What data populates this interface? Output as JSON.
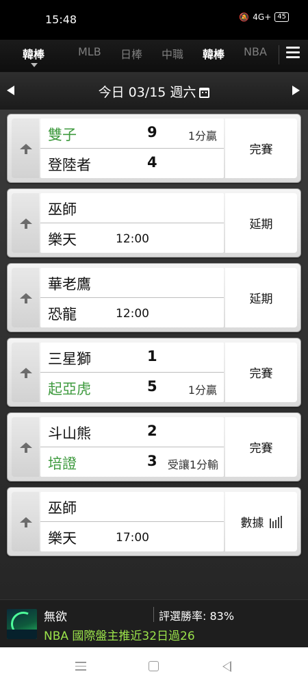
{
  "status_bar": {
    "time": "15:48",
    "signal": "4G+",
    "battery": "45"
  },
  "tabs": [
    {
      "label": "韓棒",
      "active": true
    },
    {
      "label": "MLB",
      "active": false
    },
    {
      "label": "日棒",
      "active": false
    },
    {
      "label": "中職",
      "active": false
    },
    {
      "label": "韓棒",
      "active": false
    },
    {
      "label": "NBA",
      "active": false
    }
  ],
  "date_bar": {
    "label": "今日 03/15 週六"
  },
  "games": [
    {
      "home": "雙子",
      "home_score": "9",
      "home_note": "1分贏",
      "home_win": true,
      "away": "登陸者",
      "away_score": "4",
      "away_note": "",
      "time": "",
      "status": "完賽"
    },
    {
      "home": "巫師",
      "home_score": "",
      "home_note": "",
      "away": "樂天",
      "away_score": "",
      "away_note": "",
      "time": "12:00",
      "status": "延期"
    },
    {
      "home": "華老鷹",
      "home_score": "",
      "home_note": "",
      "away": "恐龍",
      "away_score": "",
      "away_note": "",
      "time": "12:00",
      "status": "延期"
    },
    {
      "home": "三星獅",
      "home_score": "1",
      "home_note": "",
      "away": "起亞虎",
      "away_score": "5",
      "away_note": "1分贏",
      "away_win": true,
      "time": "",
      "status": "完賽"
    },
    {
      "home": "斗山熊",
      "home_score": "2",
      "home_note": "",
      "away": "培證",
      "away_score": "3",
      "away_note": "受讓1分輸",
      "away_win": true,
      "time": "",
      "status": "完賽"
    },
    {
      "home": "巫師",
      "home_score": "",
      "home_note": "",
      "away": "樂天",
      "away_score": "",
      "away_note": "",
      "time": "17:00",
      "status": "數據"
    }
  ],
  "banner": {
    "user": "無欲",
    "rate": "評選勝率: 83%",
    "promo": "NBA 國際盤主推近32日過26"
  },
  "colors": {
    "win_green": "#3e9a3e",
    "promo_green": "#9be34a"
  }
}
